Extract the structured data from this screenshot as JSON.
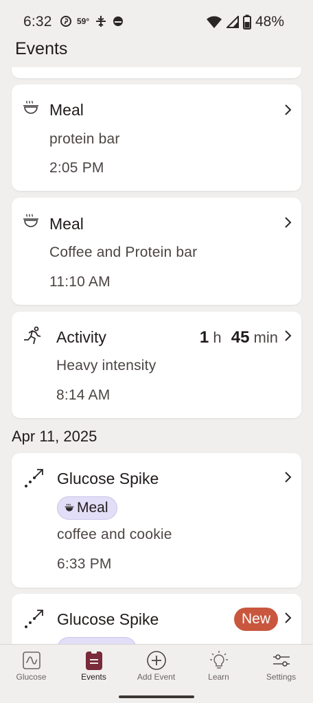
{
  "status_bar": {
    "time": "6:32",
    "temperature": "59°",
    "battery": "48%"
  },
  "header": {
    "title": "Events"
  },
  "events": [
    {
      "type": "Meal",
      "description": "protein bar",
      "time": "2:05 PM",
      "icon": "meal-icon"
    },
    {
      "type": "Meal",
      "description": "Coffee and Protein bar",
      "time": "11:10 AM",
      "icon": "meal-icon"
    },
    {
      "type": "Activity",
      "description": "Heavy intensity",
      "time": "8:14 AM",
      "icon": "running-icon",
      "duration": {
        "hours": "1",
        "hours_unit": "h",
        "minutes": "45",
        "minutes_unit": "min"
      }
    }
  ],
  "date_group": {
    "date": "Apr 11, 2025"
  },
  "spike_events": [
    {
      "type": "Glucose Spike",
      "tag": "Meal",
      "description": "coffee and cookie",
      "time": "6:33 PM",
      "icon": "glucose-spike-icon"
    },
    {
      "type": "Glucose Spike",
      "badge": "New",
      "icon": "glucose-spike-icon"
    }
  ],
  "bottom_nav": {
    "items": [
      {
        "label": "Glucose",
        "icon": "glucose-chart-icon"
      },
      {
        "label": "Events",
        "icon": "events-clipboard-icon",
        "active": true
      },
      {
        "label": "Add Event",
        "icon": "add-circle-icon"
      },
      {
        "label": "Learn",
        "icon": "lightbulb-icon"
      },
      {
        "label": "Settings",
        "icon": "sliders-icon"
      }
    ]
  },
  "colors": {
    "background": "#f1efed",
    "card": "#ffffff",
    "accent": "#7a2a3a",
    "chip": "#e3def7",
    "new_badge": "#c8573e"
  }
}
